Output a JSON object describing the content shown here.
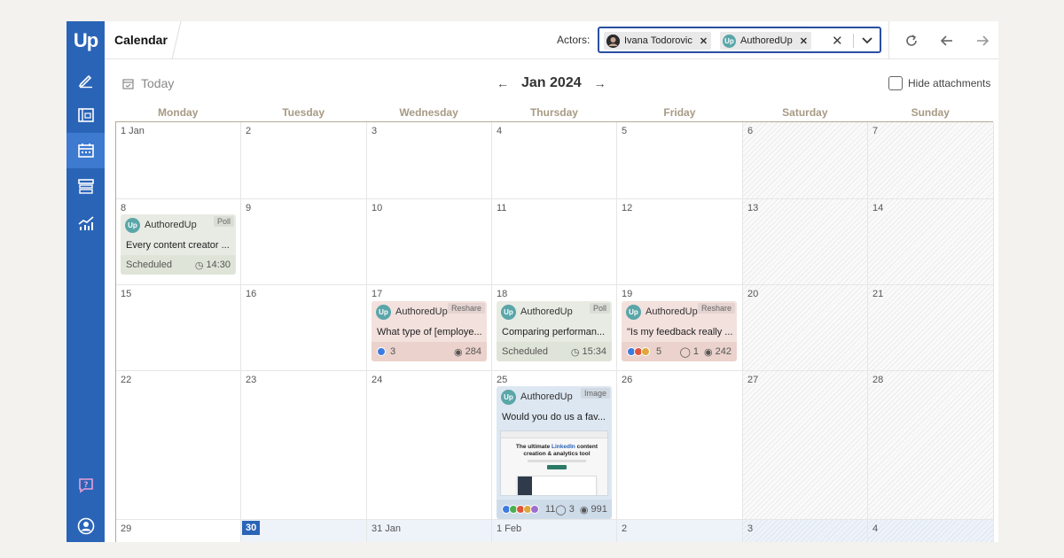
{
  "header": {
    "title": "Calendar",
    "actors_label": "Actors:",
    "actors": [
      {
        "name": "Ivana Todorovic",
        "avatar": "IT",
        "color": "#3a3a3a"
      },
      {
        "name": "AuthoredUp",
        "avatar": "Up",
        "color": "#5aa6a9"
      }
    ],
    "clear_icon": "✕",
    "dropdown_icon": "▾",
    "refresh_icon": "↻",
    "back_icon": "←",
    "forward_icon": "→"
  },
  "sidebar": {
    "logo": "Up",
    "items": [
      {
        "name": "editor",
        "icon": "pen-icon"
      },
      {
        "name": "library",
        "icon": "layout-icon"
      },
      {
        "name": "calendar",
        "icon": "calendar-icon",
        "active": true
      },
      {
        "name": "archive",
        "icon": "archive-icon"
      },
      {
        "name": "analytics",
        "icon": "analytics-icon"
      },
      {
        "name": "help",
        "icon": "help-icon"
      },
      {
        "name": "account",
        "icon": "user-icon"
      }
    ]
  },
  "toolbar": {
    "today_label": "Today",
    "month_label": "Jan 2024",
    "prev_icon": "←",
    "next_icon": "→",
    "hide_attachments_label": "Hide attachments"
  },
  "weekdays": [
    "Monday",
    "Tuesday",
    "Wednesday",
    "Thursday",
    "Friday",
    "Saturday",
    "Sunday"
  ],
  "weeks": [
    [
      "1 Jan",
      "2",
      "3",
      "4",
      "5",
      "6",
      "7"
    ],
    [
      "8",
      "9",
      "10",
      "11",
      "12",
      "13",
      "14"
    ],
    [
      "15",
      "16",
      "17",
      "18",
      "19",
      "20",
      "21"
    ],
    [
      "22",
      "23",
      "24",
      "25",
      "26",
      "27",
      "28"
    ],
    [
      "29",
      "30",
      "31 Jan",
      "1 Feb",
      "2",
      "3",
      "4"
    ]
  ],
  "today": "30",
  "posts": {
    "jan8": {
      "author": "AuthoredUp",
      "badge": "Poll",
      "text": "Every content creator ...",
      "status": "Scheduled",
      "time": "14:30"
    },
    "jan17": {
      "author": "AuthoredUp",
      "badge": "Reshare",
      "text": "What type of [employe...",
      "reactions": "3",
      "views": "284"
    },
    "jan18": {
      "author": "AuthoredUp",
      "badge": "Poll",
      "text": "Comparing performan...",
      "status": "Scheduled",
      "time": "15:34"
    },
    "jan19": {
      "author": "AuthoredUp",
      "badge": "Reshare",
      "text": "\"Is my feedback really ...",
      "reactions": "5",
      "comments": "1",
      "views": "242"
    },
    "jan25": {
      "author": "AuthoredUp",
      "badge": "Image",
      "text": "Would you do us a fav...",
      "reactions": "11",
      "comments": "3",
      "views": "991",
      "thumb_headline_1": "The ultimate",
      "thumb_headline_brand": "LinkedIn",
      "thumb_headline_2": "content creation & analytics tool"
    }
  }
}
